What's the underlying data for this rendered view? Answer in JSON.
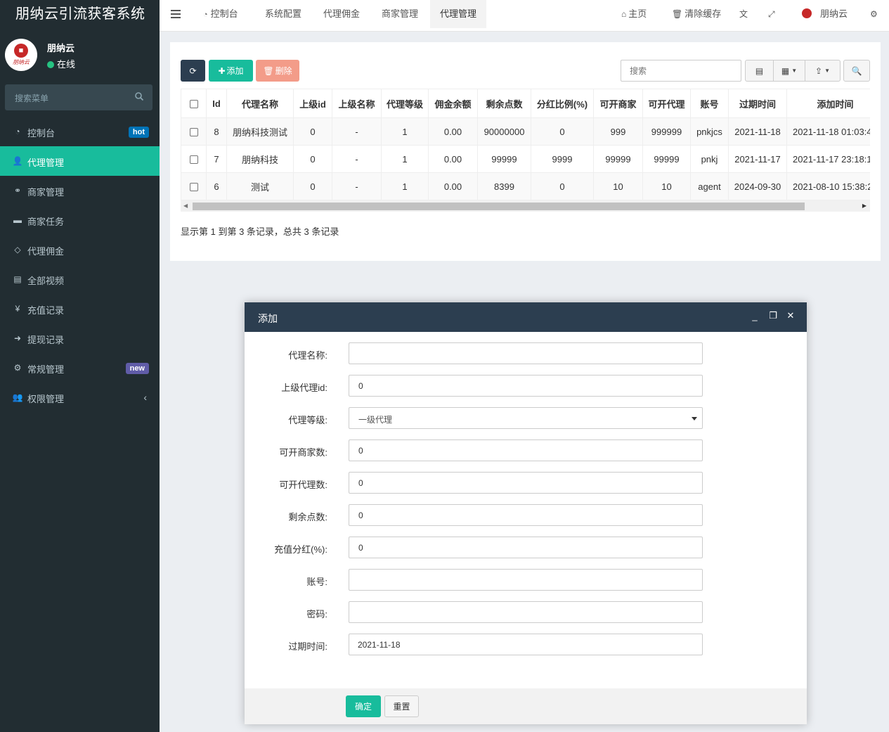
{
  "app": {
    "title": "朋纳云引流获客系统"
  },
  "user": {
    "name": "朋纳云",
    "status": "在线",
    "avatar_caption": "朋纳云"
  },
  "sidebar": {
    "search_placeholder": "搜索菜单",
    "items": [
      {
        "label": "控制台",
        "icon": "dashboard-icon",
        "badge": "hot"
      },
      {
        "label": "代理管理",
        "icon": "user-add-icon",
        "active": true
      },
      {
        "label": "商家管理",
        "icon": "handshake-icon"
      },
      {
        "label": "商家任务",
        "icon": "card-icon"
      },
      {
        "label": "代理佣金",
        "icon": "diamond-icon"
      },
      {
        "label": "全部视频",
        "icon": "file-video-icon"
      },
      {
        "label": "充值记录",
        "icon": "yen-icon"
      },
      {
        "label": "提现记录",
        "icon": "sign-in-icon"
      },
      {
        "label": "常规管理",
        "icon": "cogs-icon",
        "badge": "new"
      },
      {
        "label": "权限管理",
        "icon": "users-icon"
      }
    ]
  },
  "topbar": {
    "tabs": [
      {
        "label": "控制台",
        "icon": "dashboard-icon"
      },
      {
        "label": "系统配置"
      },
      {
        "label": "代理佣金"
      },
      {
        "label": "商家管理"
      },
      {
        "label": "代理管理",
        "active": true
      }
    ],
    "right": {
      "home": "主页",
      "clear_cache": "清除缓存",
      "username": "朋纳云"
    }
  },
  "toolbar": {
    "add": "添加",
    "delete": "删除",
    "search_placeholder": "搜索"
  },
  "table": {
    "columns": [
      "Id",
      "代理名称",
      "上级id",
      "上级名称",
      "代理等级",
      "佣金余额",
      "剩余点数",
      "分红比例(%)",
      "可开商家",
      "可开代理",
      "账号",
      "过期时间",
      "添加时间"
    ],
    "rows": [
      [
        "8",
        "朋纳科技测试",
        "0",
        "-",
        "1",
        "0.00",
        "90000000",
        "0",
        "999",
        "999999",
        "pnkjcs",
        "2021-11-18",
        "2021-11-18 01:03:4"
      ],
      [
        "7",
        "朋纳科技",
        "0",
        "-",
        "1",
        "0.00",
        "99999",
        "9999",
        "99999",
        "99999",
        "pnkj",
        "2021-11-17",
        "2021-11-17 23:18:1"
      ],
      [
        "6",
        "测试",
        "0",
        "-",
        "1",
        "0.00",
        "8399",
        "0",
        "10",
        "10",
        "agent",
        "2024-09-30",
        "2021-08-10 15:38:2"
      ]
    ],
    "page_info": "显示第 1 到第 3 条记录，总共 3 条记录"
  },
  "modal": {
    "title": "添加",
    "fields": [
      {
        "label": "代理名称:",
        "value": ""
      },
      {
        "label": "上级代理id:",
        "value": "0"
      },
      {
        "label": "代理等级:",
        "value": "一级代理"
      },
      {
        "label": "可开商家数:",
        "value": "0"
      },
      {
        "label": "可开代理数:",
        "value": "0"
      },
      {
        "label": "剩余点数:",
        "value": "0"
      },
      {
        "label": "充值分红(%):",
        "value": "0"
      },
      {
        "label": "账号:",
        "value": ""
      },
      {
        "label": "密码:",
        "value": ""
      },
      {
        "label": "过期时间:",
        "value": "2021-11-18"
      }
    ],
    "ok": "确定",
    "reset": "重置"
  },
  "colors": {
    "sidebar_bg": "#222d32",
    "accent": "#18bc9c",
    "header_dark": "#2c3e50",
    "danger_light": "#f39c89",
    "badge_hot": "#0073b7",
    "badge_new": "#605ca8"
  }
}
